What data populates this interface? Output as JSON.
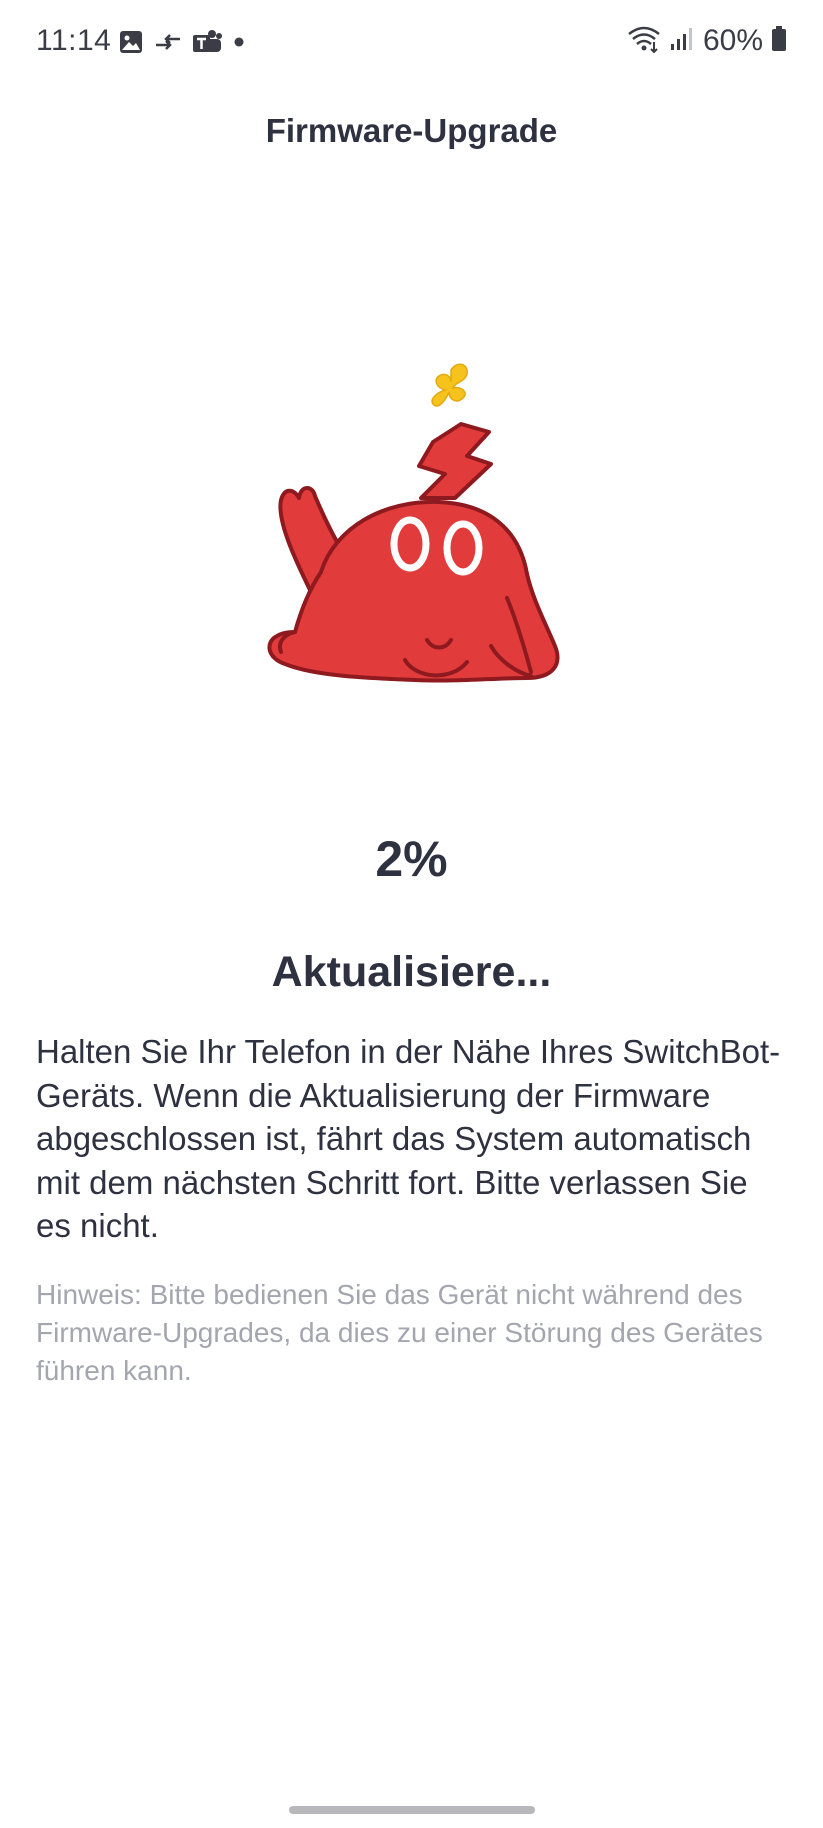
{
  "status_bar": {
    "time": "11:14",
    "battery": "60%",
    "icons": [
      "gallery-icon",
      "data-transfer-icon",
      "teams-icon",
      "notification-dot-icon",
      "wifi-icon",
      "signal-icon",
      "battery-icon"
    ]
  },
  "header": {
    "title": "Firmware-Upgrade"
  },
  "progress": {
    "percent_text": "2%",
    "value": 0.02,
    "status": "Aktualisiere...",
    "instruction": "Halten Sie Ihr Telefon in der Nähe Ihres SwitchBot-Geräts. Wenn die Aktualisierung der Firmware abgeschlossen ist, fährt das System automatisch mit dem nächsten Schritt fort. Bitte verlassen Sie es nicht.",
    "hint": "Hinweis: Bitte bedienen Sie das Gerät nicht während des Firmware-Upgrades, da dies zu einer Störung des Gerätes führen kann."
  },
  "colors": {
    "mascot_red": "#e23b3b",
    "mascot_outline": "#8e1a1f",
    "sparkle_yellow": "#f6c31c",
    "text_primary": "#2e3140",
    "text_hint": "#a3a6ae"
  },
  "mascot": {
    "name": "switchbot-mascot-illustration"
  }
}
